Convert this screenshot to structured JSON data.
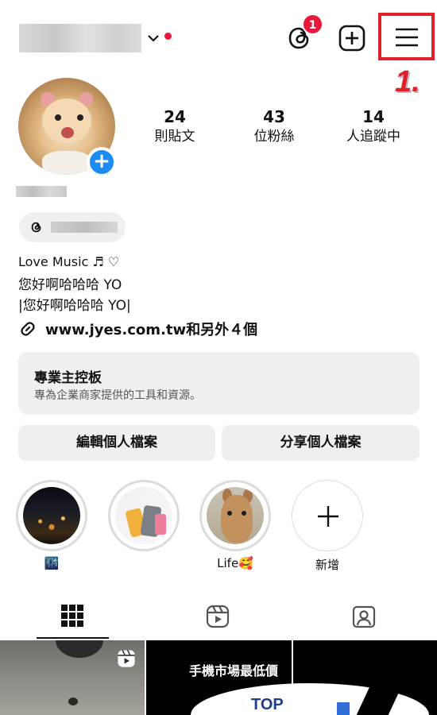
{
  "header": {
    "notification_count": "1",
    "step_annotation": "1."
  },
  "profile": {
    "stats": [
      {
        "value": "24",
        "label": "則貼文"
      },
      {
        "value": "43",
        "label": "位粉絲"
      },
      {
        "value": "14",
        "label": "人追蹤中"
      }
    ],
    "bio": {
      "line1": "Love Music ♬ ♡",
      "line2": "您好啊哈哈哈 YO",
      "line3": "|您好啊哈哈哈 YO|"
    },
    "link_text": "www.jyes.com.tw和另外４個"
  },
  "professional_dashboard": {
    "title": "專業主控板",
    "subtitle": "專為企業商家提供的工具和資源。"
  },
  "actions": {
    "edit_profile": "編輯個人檔案",
    "share_profile": "分享個人檔案"
  },
  "highlights": [
    {
      "caption": "🌃"
    },
    {
      "caption": ""
    },
    {
      "caption": "Life🥰"
    },
    {
      "caption": "新增"
    }
  ],
  "grid": {
    "promo_text": "手機市場最低價",
    "brand_text": "TOP"
  },
  "colors": {
    "accent_red": "#e0202a",
    "badge_red": "#e8193c",
    "avatar_plus_blue": "#1d8cf2"
  }
}
